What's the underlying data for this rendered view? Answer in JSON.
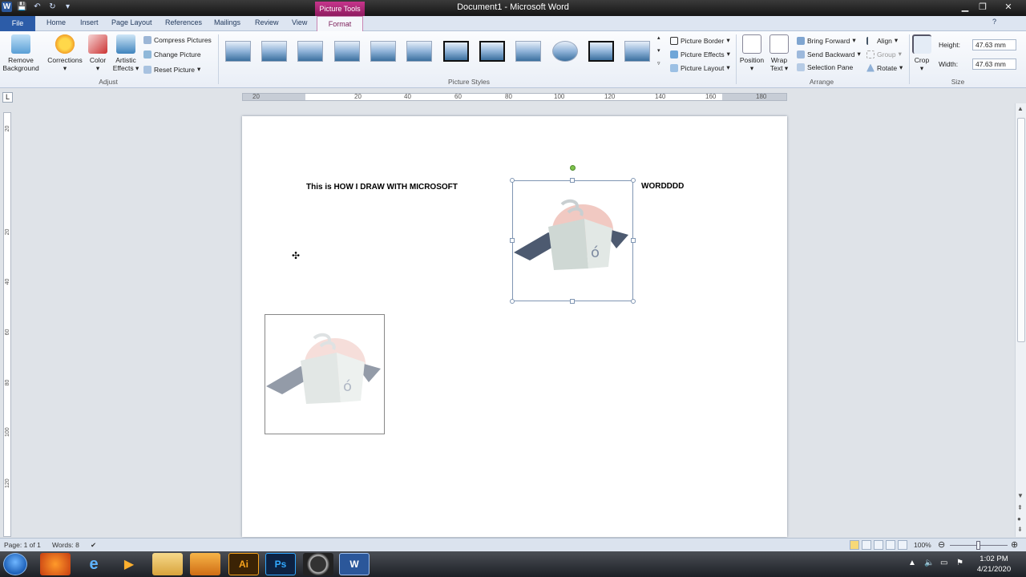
{
  "window": {
    "title": "Document1 - Microsoft Word",
    "contextual_tab_title": "Picture Tools"
  },
  "tabs": {
    "file": "File",
    "items": [
      "Home",
      "Insert",
      "Page Layout",
      "References",
      "Mailings",
      "Review",
      "View"
    ],
    "active": "Format"
  },
  "ribbon": {
    "adjust": {
      "remove_background_line1": "Remove",
      "remove_background_line2": "Background",
      "corrections": "Corrections",
      "color": "Color",
      "artistic_line1": "Artistic",
      "artistic_line2": "Effects",
      "compress": "Compress Pictures",
      "change": "Change Picture",
      "reset": "Reset Picture",
      "label": "Adjust"
    },
    "picture_styles": {
      "border": "Picture Border",
      "effects": "Picture Effects",
      "layout": "Picture Layout",
      "label": "Picture Styles"
    },
    "arrange": {
      "position": "Position",
      "wrap_line1": "Wrap",
      "wrap_line2": "Text",
      "bring_forward": "Bring Forward",
      "send_backward": "Send Backward",
      "selection_pane": "Selection Pane",
      "align": "Align",
      "group": "Group",
      "rotate": "Rotate",
      "label": "Arrange"
    },
    "size": {
      "crop": "Crop",
      "height_label": "Height:",
      "height_value": "47.63 mm",
      "width_label": "Width:",
      "width_value": "47.63 mm",
      "label": "Size"
    }
  },
  "ruler": {
    "ticks": [
      "20",
      "20",
      "40",
      "60",
      "80",
      "100",
      "120",
      "140",
      "160",
      "180"
    ],
    "vticks": [
      "20",
      "20",
      "40",
      "60",
      "80",
      "100",
      "120"
    ]
  },
  "document": {
    "text_left": "This is HOW I DRAW WITH MICROSOFT",
    "text_right": "WORDDDD"
  },
  "status": {
    "page": "Page: 1 of 1",
    "words": "Words: 8",
    "zoom": "100%"
  },
  "taskbar": {
    "apps": [
      "firefox",
      "internet-explorer",
      "media-player",
      "file-explorer",
      "fl-studio",
      "Ai",
      "Ps",
      "obs",
      "W"
    ],
    "time": "1:02 PM",
    "date": "4/21/2020"
  }
}
